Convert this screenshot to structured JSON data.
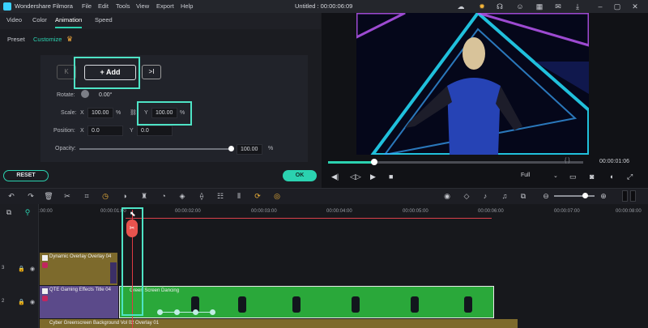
{
  "titlebar": {
    "app_name": "Wondershare Filmora",
    "menu": [
      "File",
      "Edit",
      "Tools",
      "View",
      "Export",
      "Help"
    ],
    "document_title": "Untitled : 00:00:06:09"
  },
  "panel_tabs": [
    "Video",
    "Color",
    "Animation",
    "Speed"
  ],
  "panel_tabs_active": "Animation",
  "sub_tabs": [
    "Preset",
    "Customize"
  ],
  "sub_tabs_active": "Customize",
  "editor": {
    "add_label": "Add",
    "prev_keyframe": "K",
    "next_keyframe": ">I",
    "rotate_label": "Rotate:",
    "rotate_value": "0.00°",
    "scale_label": "Scale:",
    "scale_x_label": "X",
    "scale_x_value": "100.00",
    "scale_unit": "%",
    "scale_y_label": "Y",
    "scale_y_value": "100.00",
    "position_label": "Position:",
    "position_x_label": "X",
    "position_x_value": "0.0",
    "position_y_label": "Y",
    "position_y_value": "0.0",
    "opacity_label": "Opacity:",
    "opacity_value": "100.00",
    "opacity_unit": "%",
    "opacity_level": 1.0
  },
  "reset_label": "RESET",
  "ok_label": "OK",
  "preview": {
    "time": "00:00:01:06",
    "quality": "Full",
    "progress": 0.18,
    "brackets": "{ }"
  },
  "timeline": {
    "ruler_ticks": [
      ":00:00",
      "00:00:01:00",
      "00:00:02:00",
      "00:00:03:00",
      "00:00:04:00",
      "00:00:05:00",
      "00:00:06:00",
      "00:00:07:00",
      "00:00:08:00"
    ],
    "tracks": [
      {
        "number": "3"
      },
      {
        "number": "2"
      }
    ],
    "clips": {
      "overlay": "Dynamic Overlay Overlay 04",
      "title": "QTE Gaming Effects Title 04",
      "green": "Green Screen Dancing",
      "background": "Cyber Greenscreen Background Vol 02 Overlay 01"
    }
  }
}
